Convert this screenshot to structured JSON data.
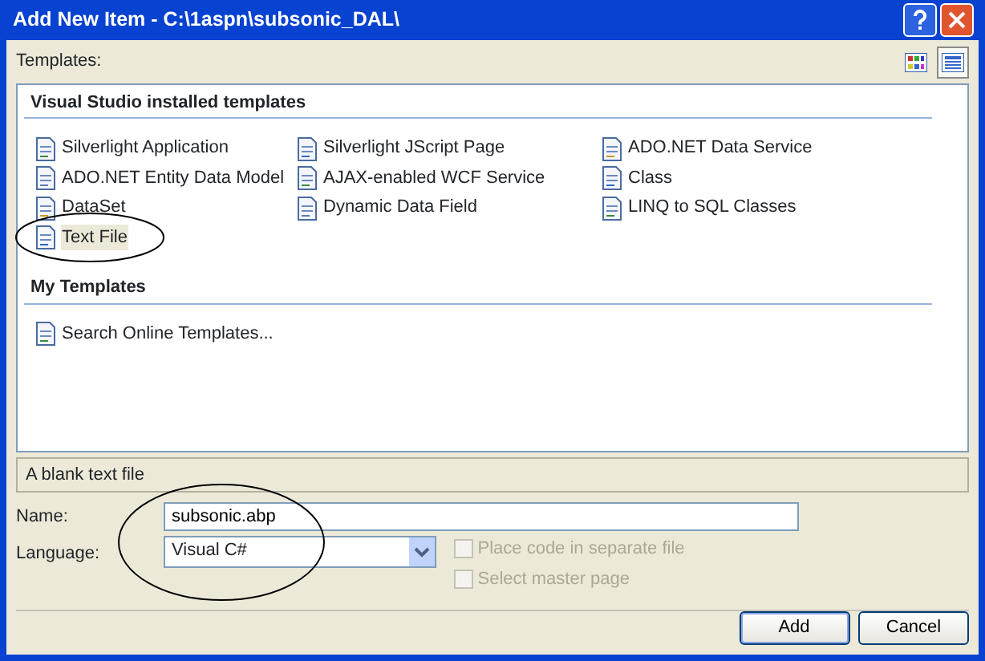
{
  "window": {
    "title": "Add New Item - C:\\1aspn\\subsonic_DAL\\"
  },
  "view_buttons": [
    {
      "kind": "large",
      "selected": false
    },
    {
      "kind": "small",
      "selected": true
    }
  ],
  "templates_label": "Templates:",
  "sections": [
    {
      "title": "Visual Studio installed templates",
      "items": [
        {
          "label": "Silverlight Application",
          "selected": false
        },
        {
          "label": "Silverlight JScript Page",
          "selected": false
        },
        {
          "label": "ADO.NET Data Service",
          "selected": false
        },
        {
          "label": "ADO.NET Entity Data Model",
          "selected": false
        },
        {
          "label": "AJAX-enabled WCF Service",
          "selected": false
        },
        {
          "label": "Class",
          "selected": false
        },
        {
          "label": "DataSet",
          "selected": false
        },
        {
          "label": "Dynamic Data Field",
          "selected": false
        },
        {
          "label": "LINQ to SQL Classes",
          "selected": false
        },
        {
          "label": "Text File",
          "selected": true
        }
      ]
    },
    {
      "title": "My Templates",
      "items": [
        {
          "label": "Search Online Templates...",
          "selected": false
        }
      ]
    }
  ],
  "description": "A blank text file",
  "name": {
    "label": "Name:",
    "value": "subsonic.abp"
  },
  "language": {
    "label": "Language:",
    "value": "Visual C#"
  },
  "options": [
    {
      "label": "Place code in separate file",
      "checked": false,
      "disabled": true
    },
    {
      "label": "Select master page",
      "checked": false,
      "disabled": true
    }
  ],
  "buttons": [
    {
      "label": "Add",
      "kind": "default"
    },
    {
      "label": "Cancel",
      "kind": "normal"
    }
  ]
}
